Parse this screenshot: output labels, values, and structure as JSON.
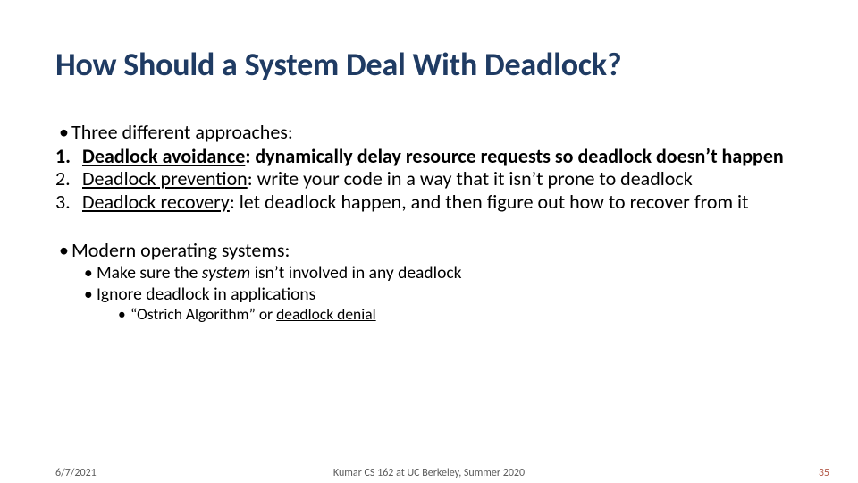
{
  "title": "How Should a System Deal With Deadlock?",
  "intro": "Three different approaches:",
  "items": [
    {
      "num": "1.",
      "label": "Deadlock avoidance",
      "rest": ": dynamically delay resource requests so deadlock doesn’t happen"
    },
    {
      "num": "2.",
      "label": "Deadlock prevention",
      "rest": ": write your code in a way that it isn’t prone to deadlock"
    },
    {
      "num": "3.",
      "label": "Deadlock recovery",
      "rest": ": let deadlock happen, and then figure out how to recover from it"
    }
  ],
  "modern_heading": "Modern operating systems:",
  "modern_sub1_a": "Make sure the ",
  "modern_sub1_b": "system",
  "modern_sub1_c": " isn’t involved in any deadlock",
  "modern_sub2": "Ignore deadlock in applications",
  "modern_sub3_a": "“Ostrich Algorithm” or ",
  "modern_sub3_b": "deadlock denial",
  "footer": {
    "date": "6/7/2021",
    "center": "Kumar CS 162 at UC Berkeley, Summer 2020",
    "pagenum": "35"
  }
}
